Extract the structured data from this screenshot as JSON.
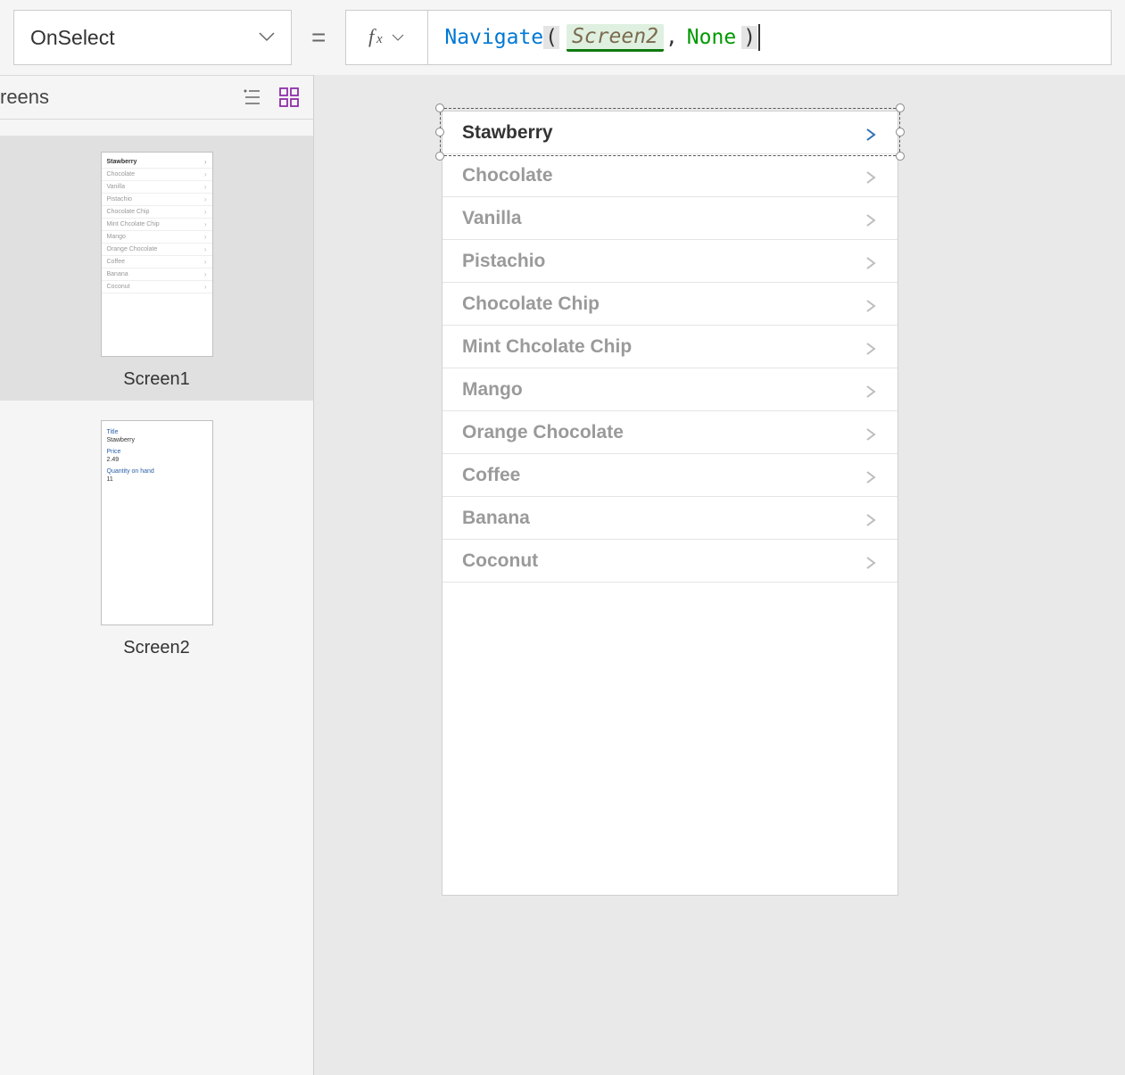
{
  "propertySelector": {
    "value": "OnSelect"
  },
  "equalsSign": "=",
  "formula": {
    "func": "Navigate",
    "open": "(",
    "arg1": "Screen2",
    "comma": ",",
    "arg2": "None",
    "close": ")"
  },
  "panel": {
    "title": "reens"
  },
  "thumbnails": {
    "screen1": {
      "label": "Screen1",
      "items": [
        "Stawberry",
        "Chocolate",
        "Vanilla",
        "Pistachio",
        "Chocolate Chip",
        "Mint Chcolate Chip",
        "Mango",
        "Orange Chocolate",
        "Coffee",
        "Banana",
        "Coconut"
      ]
    },
    "screen2": {
      "label": "Screen2",
      "fields": {
        "titleLabel": "Title",
        "titleValue": "Stawberry",
        "priceLabel": "Price",
        "priceValue": "2.49",
        "qtyLabel": "Quantity on hand",
        "qtyValue": "11"
      }
    }
  },
  "gallery": {
    "items": [
      {
        "label": "Stawberry",
        "selected": true
      },
      {
        "label": "Chocolate"
      },
      {
        "label": "Vanilla"
      },
      {
        "label": "Pistachio"
      },
      {
        "label": "Chocolate Chip"
      },
      {
        "label": "Mint Chcolate Chip"
      },
      {
        "label": "Mango"
      },
      {
        "label": "Orange Chocolate"
      },
      {
        "label": "Coffee"
      },
      {
        "label": "Banana"
      },
      {
        "label": "Coconut"
      }
    ]
  }
}
